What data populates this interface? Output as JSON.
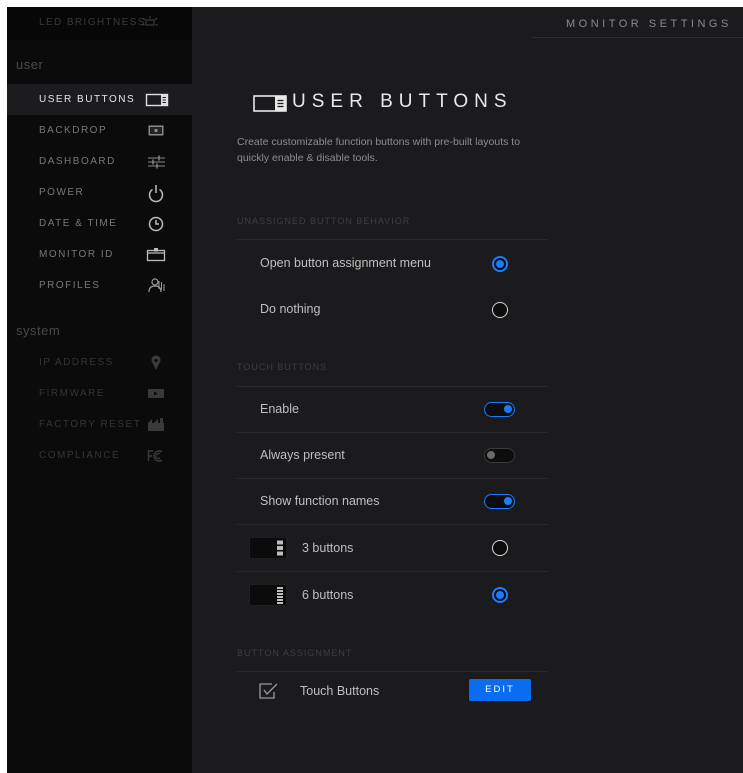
{
  "header": {
    "title": "MONITOR SETTINGS"
  },
  "sidebar": {
    "top_item": {
      "label": "LED BRIGHTNESS",
      "icon": "led-brightness-icon"
    },
    "user_section": "user",
    "user_items": [
      {
        "label": "USER BUTTONS",
        "icon": "user-buttons-icon",
        "active": true
      },
      {
        "label": "BACKDROP",
        "icon": "backdrop-icon"
      },
      {
        "label": "DASHBOARD",
        "icon": "sliders-icon"
      },
      {
        "label": "POWER",
        "icon": "power-icon"
      },
      {
        "label": "DATE & TIME",
        "icon": "clock-icon"
      },
      {
        "label": "MONITOR ID",
        "icon": "monitor-id-icon"
      },
      {
        "label": "PROFILES",
        "icon": "profiles-icon"
      }
    ],
    "system_section": "system",
    "system_items": [
      {
        "label": "IP ADDRESS",
        "icon": "location-pin-icon"
      },
      {
        "label": "FIRMWARE",
        "icon": "firmware-icon"
      },
      {
        "label": "FACTORY RESET",
        "icon": "factory-reset-icon"
      },
      {
        "label": "COMPLIANCE",
        "icon": "fcc-icon"
      }
    ]
  },
  "main": {
    "title": "USER BUTTONS",
    "description": "Create customizable function buttons with pre-built layouts to quickly enable & disable tools.",
    "unassigned": {
      "label": "UNASSIGNED BUTTON BEHAVIOR",
      "options": [
        {
          "label": "Open button assignment menu",
          "selected": true
        },
        {
          "label": "Do nothing",
          "selected": false
        }
      ]
    },
    "touch_buttons": {
      "label": "TOUCH BUTTONS",
      "toggles": [
        {
          "label": "Enable",
          "on": true
        },
        {
          "label": "Always present",
          "on": false
        },
        {
          "label": "Show function names",
          "on": true
        }
      ],
      "layouts": [
        {
          "label": "3 buttons",
          "selected": false
        },
        {
          "label": "6 buttons",
          "selected": true
        }
      ]
    },
    "assignment": {
      "label": "BUTTON ASSIGNMENT",
      "item_label": "Touch Buttons",
      "edit_label": "EDIT"
    }
  },
  "colors": {
    "accent": "#1c7cff",
    "background": "#1b1b1d",
    "sidebar": "#0b0b0b"
  }
}
